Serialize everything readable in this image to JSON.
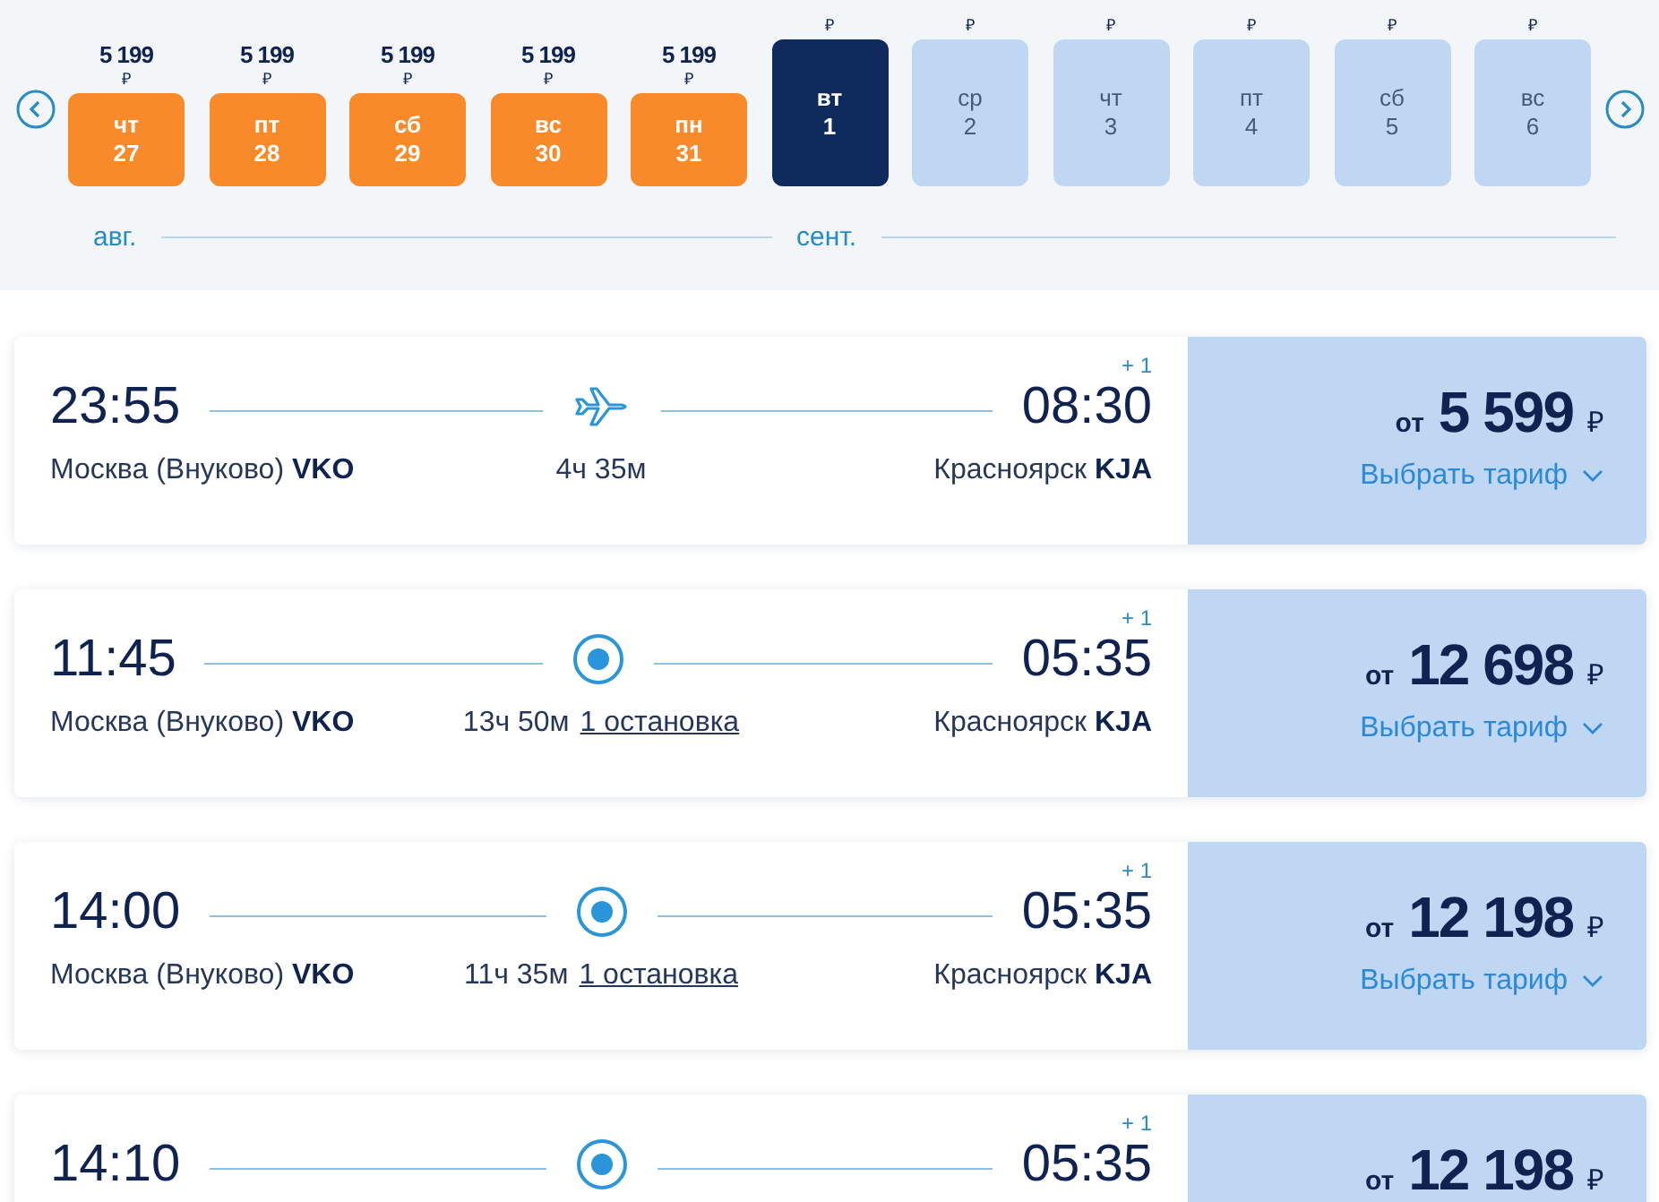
{
  "date_strip": {
    "days": [
      {
        "price": "5 199",
        "currency": "₽",
        "weekday": "чт",
        "day": "27",
        "month": "авг.",
        "kind": "lowest",
        "selected": false
      },
      {
        "price": "5 199",
        "currency": "₽",
        "weekday": "пт",
        "day": "28",
        "kind": "lowest",
        "selected": false
      },
      {
        "price": "5 199",
        "currency": "₽",
        "weekday": "сб",
        "day": "29",
        "kind": "lowest",
        "selected": false
      },
      {
        "price": "5 199",
        "currency": "₽",
        "weekday": "вс",
        "day": "30",
        "kind": "lowest",
        "selected": false
      },
      {
        "price": "5 199",
        "currency": "₽",
        "weekday": "пн",
        "day": "31",
        "kind": "lowest",
        "selected": false
      },
      {
        "currency": "₽",
        "weekday": "вт",
        "day": "1",
        "month": "сент.",
        "kind": "regular",
        "selected": true
      },
      {
        "currency": "₽",
        "weekday": "ср",
        "day": "2",
        "kind": "regular",
        "selected": false
      },
      {
        "currency": "₽",
        "weekday": "чт",
        "day": "3",
        "kind": "regular",
        "selected": false
      },
      {
        "currency": "₽",
        "weekday": "пт",
        "day": "4",
        "kind": "regular",
        "selected": false
      },
      {
        "currency": "₽",
        "weekday": "сб",
        "day": "5",
        "kind": "regular",
        "selected": false
      },
      {
        "currency": "₽",
        "weekday": "вс",
        "day": "6",
        "kind": "regular",
        "selected": false
      }
    ]
  },
  "flights": [
    {
      "kind": "direct",
      "departure": "23:55",
      "arrival": "08:30",
      "next_day": "+ 1",
      "from_city": "Москва (Внуково)",
      "from_code": "VKO",
      "to_city": "Красноярск",
      "to_code": "KJA",
      "duration": "4ч 35м",
      "price_prefix": "от",
      "price": "5 599",
      "currency": "₽",
      "fare_link": "Выбрать тариф"
    },
    {
      "kind": "stops",
      "departure": "11:45",
      "arrival": "05:35",
      "next_day": "+ 1",
      "from_city": "Москва (Внуково)",
      "from_code": "VKO",
      "to_city": "Красноярск",
      "to_code": "KJA",
      "duration": "13ч 50м",
      "stops": "1 остановка",
      "price_prefix": "от",
      "price": "12 698",
      "currency": "₽",
      "fare_link": "Выбрать тариф"
    },
    {
      "kind": "stops",
      "departure": "14:00",
      "arrival": "05:35",
      "next_day": "+ 1",
      "from_city": "Москва (Внуково)",
      "from_code": "VKO",
      "to_city": "Красноярск",
      "to_code": "KJA",
      "duration": "11ч 35м",
      "stops": "1 остановка",
      "price_prefix": "от",
      "price": "12 198",
      "currency": "₽",
      "fare_link": "Выбрать тариф"
    },
    {
      "kind": "stops",
      "departure": "14:10",
      "arrival": "05:35",
      "next_day": "+ 1",
      "price_prefix": "от",
      "price": "12 198",
      "currency": "₽"
    }
  ]
}
